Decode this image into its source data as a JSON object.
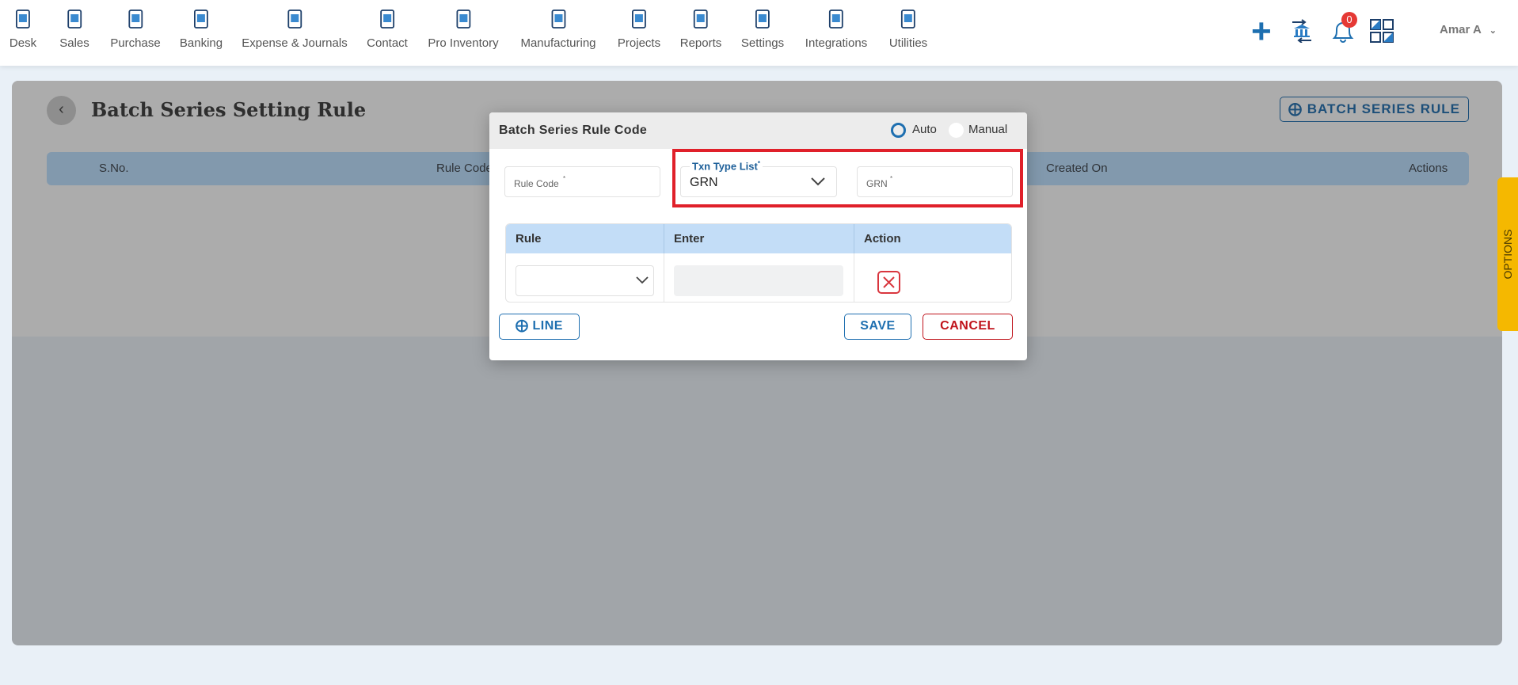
{
  "nav": {
    "items": [
      {
        "label": "Desk",
        "icon": "desk-icon"
      },
      {
        "label": "Sales",
        "icon": "sales-icon"
      },
      {
        "label": "Purchase",
        "icon": "cart-icon"
      },
      {
        "label": "Banking",
        "icon": "bank-icon"
      },
      {
        "label": "Expense & Journals",
        "icon": "journal-icon"
      },
      {
        "label": "Contact",
        "icon": "contact-icon"
      },
      {
        "label": "Pro Inventory",
        "icon": "inventory-icon"
      },
      {
        "label": "Manufacturing",
        "icon": "manufacturing-icon"
      },
      {
        "label": "Projects",
        "icon": "projects-icon"
      },
      {
        "label": "Reports",
        "icon": "reports-icon"
      },
      {
        "label": "Settings",
        "icon": "settings-icon"
      },
      {
        "label": "Integrations",
        "icon": "integrations-icon"
      },
      {
        "label": "Utilities",
        "icon": "utilities-icon"
      }
    ],
    "notification_count": "0",
    "user": "Amar A"
  },
  "page": {
    "title": "Batch Series Setting Rule",
    "add_button": "BATCH SERIES RULE",
    "columns": [
      "S.No.",
      "Rule Code",
      "Created On",
      "Actions"
    ],
    "options_tab": "OPTIONS"
  },
  "modal": {
    "title": "Batch Series Rule Code",
    "mode_options": [
      "Auto",
      "Manual"
    ],
    "selected_mode": "Auto",
    "rule_code_placeholder": "Rule Code",
    "txn_type_label": "Txn Type List",
    "txn_type_value": "GRN",
    "grn_placeholder": "GRN",
    "table_headers": [
      "Rule",
      "Enter",
      "Action"
    ],
    "line_button": "LINE",
    "save_button": "SAVE",
    "cancel_button": "CANCEL"
  },
  "colors": {
    "accent": "#1e6fb0",
    "cancel": "#c0141c",
    "highlight": "#e0202a",
    "options": "#f5b800"
  }
}
